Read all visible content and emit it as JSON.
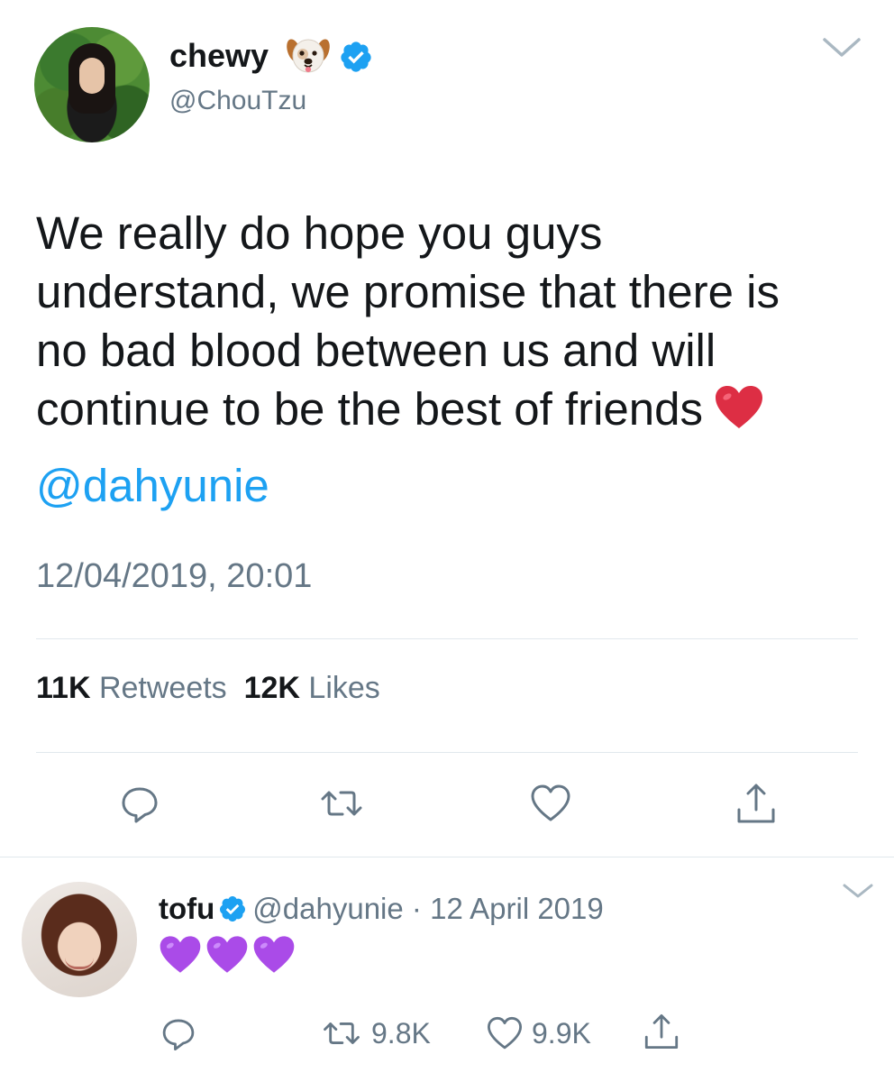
{
  "main_tweet": {
    "display_name": "chewy",
    "handle": "@ChouTzu",
    "text_lines": [
      "We really do hope you guys",
      "understand, we promise that there is",
      "no bad blood between us and will",
      "continue to be the best of friends"
    ],
    "mention": "@dahyunie",
    "timestamp": "12/04/2019, 20:01",
    "retweets_count": "11K",
    "retweets_label": "Retweets",
    "likes_count": "12K",
    "likes_label": "Likes",
    "icons": [
      "dog-face-emoji",
      "verified-badge",
      "chevron-down",
      "red-heart-emoji",
      "reply",
      "retweet",
      "like",
      "share"
    ]
  },
  "reply_tweet": {
    "display_name": "tofu",
    "handle": "@dahyunie",
    "separator": "·",
    "date": "12 April 2019",
    "emoji": [
      "purple-heart",
      "purple-heart",
      "purple-heart"
    ],
    "retweets_count": "9.8K",
    "likes_count": "9.9K"
  },
  "colors": {
    "text": "#14171a",
    "secondary": "#657786",
    "link": "#1da1f2",
    "verified": "#1da1f2",
    "divider": "#e1e8ed",
    "heart_red": "#dd2e44",
    "heart_purple": "#aa4be8"
  }
}
